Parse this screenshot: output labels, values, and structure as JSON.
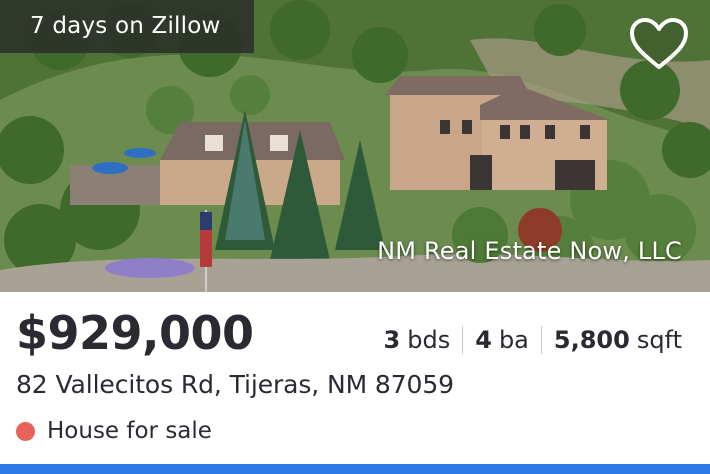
{
  "listing": {
    "days_on_site": "7 days on Zillow",
    "watermark": "NM Real Estate Now, LLC",
    "price": "$929,000",
    "beds_value": "3",
    "beds_unit": "bds",
    "baths_value": "4",
    "baths_unit": "ba",
    "sqft_value": "5,800",
    "sqft_unit": "sqft",
    "address": "82 Vallecitos Rd, Tijeras, NM 87059",
    "status": "House for sale",
    "status_color": "#e8625a",
    "favorite_icon": "heart-icon"
  },
  "theme": {
    "accent": "#2e78e6",
    "text": "#2a2a33"
  }
}
